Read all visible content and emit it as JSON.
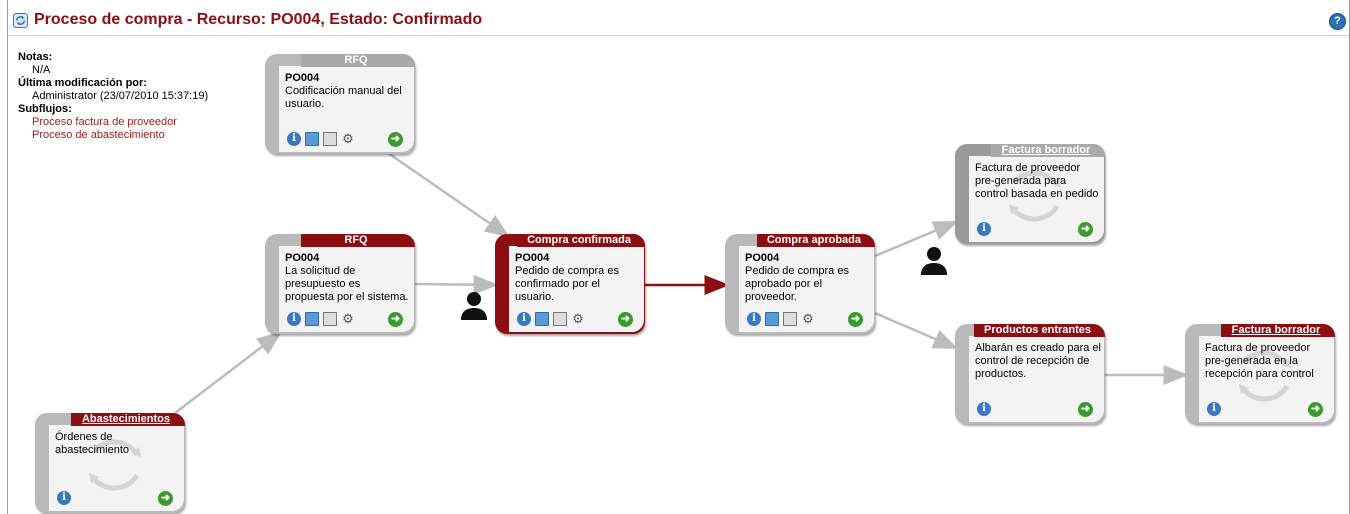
{
  "header": {
    "title": "Proceso de compra - Recurso: PO004, Estado: Confirmado",
    "help_label": "?"
  },
  "meta": {
    "notes_label": "Notas:",
    "notes_value": "N/A",
    "modified_label": "Última modificación por:",
    "modified_value": "Administrator (23/07/2010 15:37:19)",
    "subflows_label": "Subflujos:",
    "subflows": [
      "Proceso factura de proveedor",
      "Proceso de abastecimiento"
    ]
  },
  "nodes": {
    "rfq_manual": {
      "tab": "RFQ",
      "ref": "PO004",
      "text": "Codificación manual del usuario."
    },
    "rfq_system": {
      "tab": "RFQ",
      "ref": "PO004",
      "text": "La solicitud de presupuesto es propuesta por el sistema."
    },
    "compra_confirmada": {
      "tab": "Compra confirmada",
      "ref": "PO004",
      "text": "Pedido de compra es confirmado por el usuario."
    },
    "compra_aprobada": {
      "tab": "Compra aprobada",
      "ref": "PO004",
      "text": "Pedido de compra es aprobado por el proveedor."
    },
    "factura_borrador_1": {
      "tab": "Factura borrador",
      "text": "Factura de proveedor pre-generada para control basada en pedido"
    },
    "productos_entrantes": {
      "tab": "Productos entrantes",
      "text": "Albarán es creado para el control de recepción de productos."
    },
    "factura_borrador_2": {
      "tab": "Factura borrador",
      "text": "Factura de proveedor pre-generada en la recepción para control"
    },
    "abastecimientos": {
      "tab": "Abastecimientos",
      "text": "Órdenes de abastecimiento"
    }
  },
  "colors": {
    "accent": "#8a0e12",
    "inactive": "#b9b9b9",
    "link": "#9b1a1a",
    "go": "#3a9a2e"
  },
  "icon_names": [
    "info-icon",
    "folder-icon",
    "print-icon",
    "gears-icon",
    "go-next-icon",
    "user-icon",
    "cycle-icon"
  ]
}
